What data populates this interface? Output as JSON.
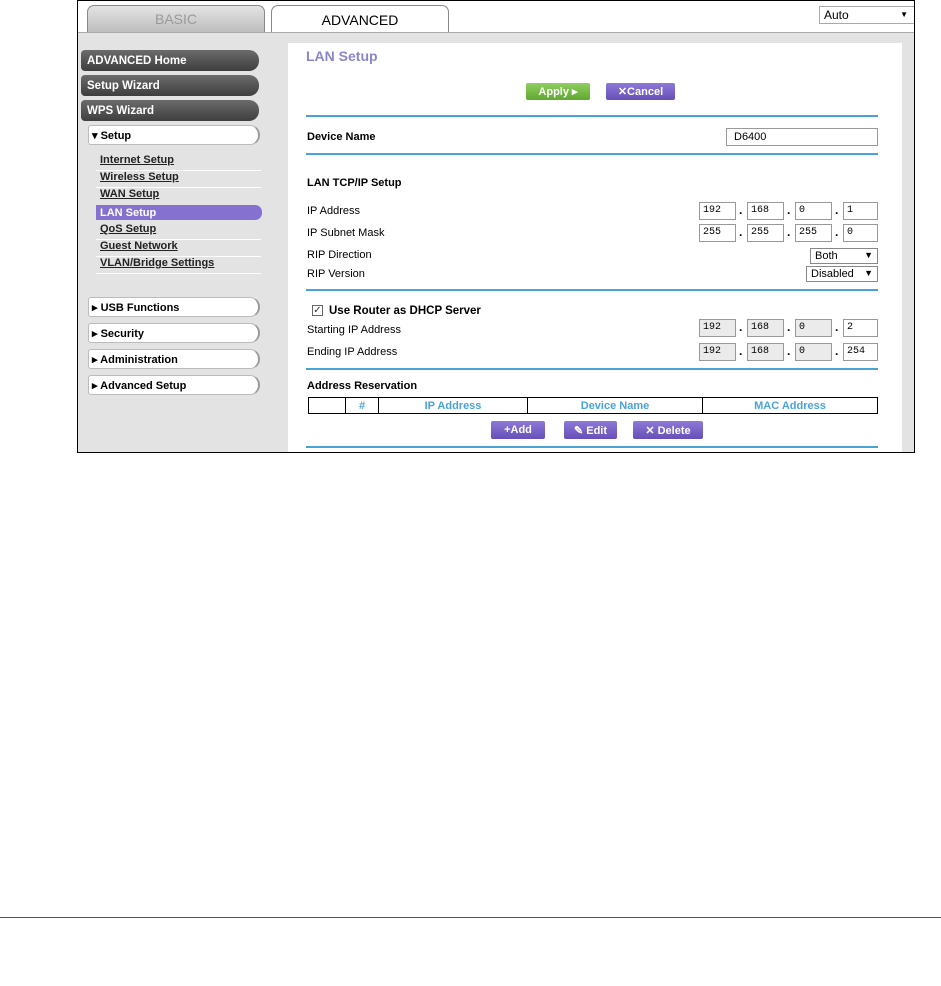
{
  "tabs": {
    "basic": "BASIC",
    "advanced": "ADVANCED"
  },
  "language_select": {
    "value": "Auto"
  },
  "sidebar": {
    "advanced_home": "ADVANCED Home",
    "setup_wizard": "Setup Wizard",
    "wps_wizard": "WPS Wizard",
    "setup": "▾ Setup",
    "setup_items": [
      "Internet Setup",
      "Wireless Setup",
      "WAN Setup",
      "LAN Setup",
      "QoS Setup",
      "Guest Network",
      "VLAN/Bridge Settings"
    ],
    "usb_functions": "▸ USB Functions",
    "security": "▸ Security",
    "administration": "▸ Administration",
    "advanced_setup": "▸ Advanced Setup"
  },
  "main": {
    "title": "LAN Setup",
    "apply": "Apply ▸",
    "cancel": "✕Cancel",
    "device_name_label": "Device Name",
    "device_name_value": "D6400",
    "tcpip_heading": "LAN TCP/IP Setup",
    "ip_address_label": "IP Address",
    "ip_address": [
      "192",
      "168",
      "0",
      "1"
    ],
    "subnet_label": "IP Subnet Mask",
    "subnet": [
      "255",
      "255",
      "255",
      "0"
    ],
    "rip_direction_label": "RIP Direction",
    "rip_direction": "Both",
    "rip_version_label": "RIP Version",
    "rip_version": "Disabled",
    "dhcp_label": "Use Router as DHCP Server",
    "dhcp_checked": true,
    "start_ip_label": "Starting IP Address",
    "start_ip": [
      "192",
      "168",
      "0",
      "2"
    ],
    "end_ip_label": "Ending IP Address",
    "end_ip": [
      "192",
      "168",
      "0",
      "254"
    ],
    "reservation_heading": "Address Reservation",
    "table_headers": [
      "",
      "#",
      "IP Address",
      "Device Name",
      "MAC Address"
    ],
    "add": "+Add",
    "edit": "✎ Edit",
    "delete": "✕ Delete"
  }
}
